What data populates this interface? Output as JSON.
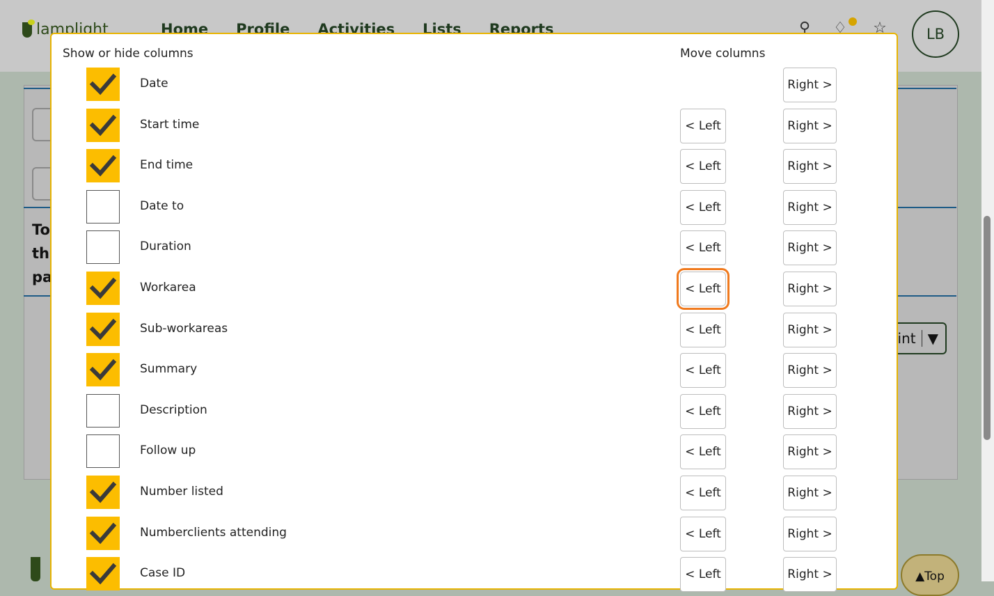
{
  "app": {
    "logo_text": "lamplight",
    "nav": [
      "Home",
      "Profile",
      "Activities",
      "Lists",
      "Reports"
    ],
    "avatar_initials": "LB",
    "bg_text_lines": [
      "To",
      "thi",
      "pa"
    ],
    "bg_print_label": "int",
    "top_button_label": "▲Top",
    "accent_color": "#fcbd00",
    "focus_color": "#f07a1e"
  },
  "modal": {
    "show_hide_header": "Show or hide columns",
    "move_header": "Move columns",
    "left_label": "< Left",
    "right_label": "Right >",
    "columns": [
      {
        "label": "Date",
        "checked": true,
        "has_left": false
      },
      {
        "label": "Start time",
        "checked": true,
        "has_left": true
      },
      {
        "label": "End time",
        "checked": true,
        "has_left": true
      },
      {
        "label": "Date to",
        "checked": false,
        "has_left": true
      },
      {
        "label": "Duration",
        "checked": false,
        "has_left": true
      },
      {
        "label": "Workarea",
        "checked": true,
        "has_left": true,
        "focused": true
      },
      {
        "label": "Sub-workareas",
        "checked": true,
        "has_left": true
      },
      {
        "label": "Summary",
        "checked": true,
        "has_left": true
      },
      {
        "label": "Description",
        "checked": false,
        "has_left": true
      },
      {
        "label": "Follow up",
        "checked": false,
        "has_left": true
      },
      {
        "label": "Number listed",
        "checked": true,
        "has_left": true
      },
      {
        "label": "Numberclients attending",
        "checked": true,
        "has_left": true
      },
      {
        "label": "Case ID",
        "checked": true,
        "has_left": true
      }
    ]
  }
}
